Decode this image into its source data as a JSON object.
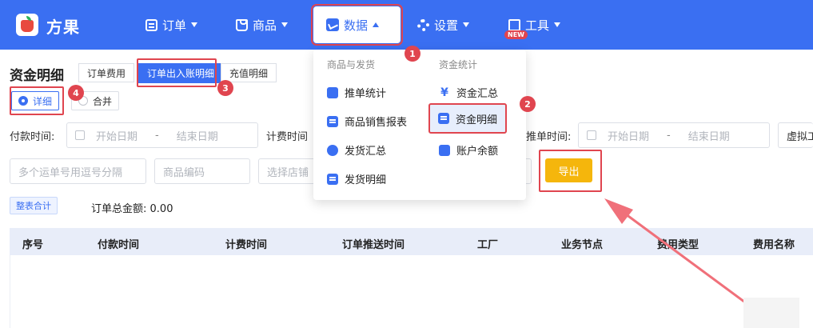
{
  "brand": {
    "name": "方果"
  },
  "nav": {
    "orders": "订单",
    "goods": "商品",
    "data": "数据",
    "settings": "设置",
    "tools": "工具",
    "tools_badge": "NEW"
  },
  "dropdown": {
    "left_header": "商品与发货",
    "right_header": "资金统计",
    "left_items": [
      "推单统计",
      "商品销售报表",
      "发货汇总",
      "发货明细"
    ],
    "right_items": [
      "资金汇总",
      "资金明细",
      "账户余额"
    ]
  },
  "page": {
    "title": "资金明细",
    "tabs": [
      "订单费用",
      "订单出入账明细",
      "充值明细"
    ],
    "modes": [
      "详细",
      "合并"
    ]
  },
  "filters": {
    "pay_time_label": "付款时间:",
    "bill_time_label": "计费时间",
    "push_time_label": "推单时间:",
    "start_placeholder": "开始日期",
    "end_placeholder": "结束日期",
    "range_sep": "-",
    "waybill_placeholder": "多个运单号用逗号分隔",
    "sku_placeholder": "商品编码",
    "shop_placeholder": "选择店铺",
    "virtual_placeholder": "虚拟工"
  },
  "actions": {
    "export": "导出"
  },
  "summary": {
    "badge": "整表合计",
    "total_label": "订单总金额:",
    "total_value": "0.00"
  },
  "table": {
    "headers": [
      "序号",
      "付款时间",
      "计费时间",
      "订单推送时间",
      "工厂",
      "业务节点",
      "费用类型",
      "费用名称"
    ]
  },
  "markers": [
    "1",
    "2",
    "3",
    "4"
  ],
  "colors": {
    "primary": "#3a6ff2",
    "annotation": "#e0454f",
    "export": "#f5b60c"
  }
}
